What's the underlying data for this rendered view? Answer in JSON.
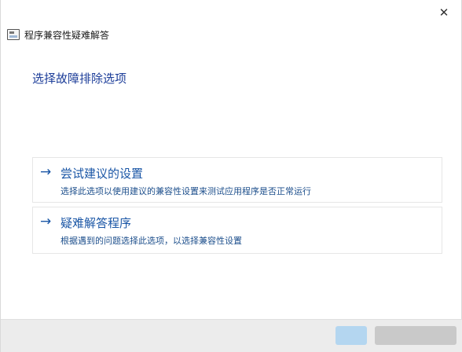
{
  "window": {
    "close_glyph": "✕",
    "title": "程序兼容性疑难解答"
  },
  "page": {
    "heading": "选择故障排除选项"
  },
  "options": [
    {
      "arrow": "→",
      "title": "尝试建议的设置",
      "description": "选择此选项以使用建议的兼容性设置来测试应用程序是否正常运行"
    },
    {
      "arrow": "→",
      "title": "疑难解答程序",
      "description": "根据遇到的问题选择此选项，以选择兼容性设置"
    }
  ],
  "colors": {
    "link_blue": "#1a56a6",
    "heading_blue": "#1c3d99",
    "footer_gray": "#ececec"
  },
  "icons": {
    "app": "app-window-icon",
    "close": "close-icon",
    "arrow": "arrow-right-icon"
  }
}
